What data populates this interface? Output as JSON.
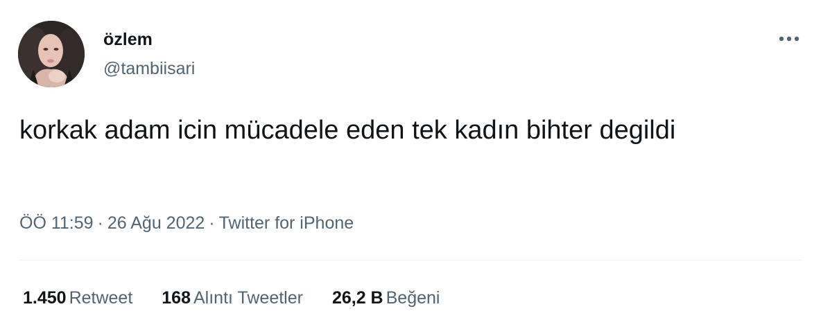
{
  "tweet": {
    "display_name": "özlem",
    "handle": "@tambiisari",
    "more_icon": "more-horizontal-icon",
    "text": "korkak adam icin mücadele eden tek kadın bihter degildi",
    "time": "ÖÖ 11:59",
    "date": "26 Ağu 2022",
    "source": "Twitter for iPhone",
    "separator": "·"
  },
  "stats": [
    {
      "count": "1.450",
      "label": "Retweet"
    },
    {
      "count": "168",
      "label": "Alıntı Tweetler"
    },
    {
      "count": "26,2 B",
      "label": "Beğeni"
    }
  ],
  "colors": {
    "text_primary": "#0f1419",
    "text_secondary": "#536471",
    "divider": "#eff3f4",
    "background": "#ffffff"
  }
}
